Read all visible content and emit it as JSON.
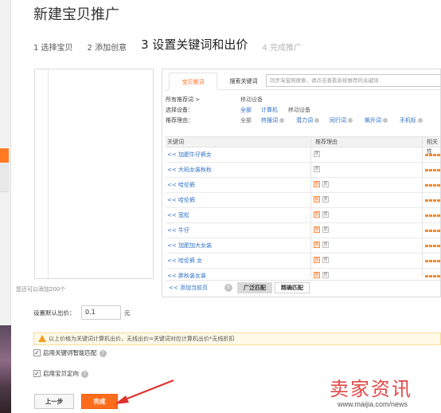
{
  "page": {
    "title": "新建宝贝推广"
  },
  "steps": [
    {
      "label": "1 选择宝贝"
    },
    {
      "label": "2 添加创意"
    },
    {
      "label": "3 设置关键词和出价"
    },
    {
      "label": "4 完成推广"
    }
  ],
  "product_panel": {
    "hint": "您还可以添加200个"
  },
  "keyword_panel": {
    "tabs": [
      {
        "label": "宝贝推词"
      },
      {
        "label": "搜索关键词"
      }
    ],
    "search_placeholder": "同步淘宝网搜索，请点击查看系统推荐的关键词",
    "filters": {
      "all_label": "所有推荐词 >",
      "all_value": "移动设备",
      "device_label": "选择设备：",
      "device_options": [
        "全部",
        "计算机",
        "移动设备"
      ],
      "reason_label": "推荐理由：",
      "reason_options": [
        "全部",
        "热搜词",
        "潜力词",
        "同行词",
        "飙升词",
        "手机标"
      ]
    },
    "table": {
      "headers": [
        "关键词",
        "推荐理由",
        "相关性"
      ],
      "rows": [
        {
          "keyword": "<< 加肥牛仔裤女",
          "tags": [
            "质"
          ]
        },
        {
          "keyword": "<< 大码女装秋秋",
          "tags": [
            "质"
          ]
        },
        {
          "keyword": "<< 哈伦裤",
          "tags": [
            "热",
            "质"
          ]
        },
        {
          "keyword": "<< 哈伦裤",
          "tags": [
            "热",
            "质"
          ]
        },
        {
          "keyword": "<< 宽松",
          "tags": [
            "热",
            "质"
          ]
        },
        {
          "keyword": "<< 牛仔",
          "tags": [
            "热",
            "质"
          ]
        },
        {
          "keyword": "<< 加肥加大女装",
          "tags": [
            "热",
            "质"
          ]
        },
        {
          "keyword": "<< 哈伦裤 女",
          "tags": [
            "热",
            "质"
          ]
        },
        {
          "keyword": "<< 胖秋装女装",
          "tags": [
            "热",
            "质"
          ]
        }
      ]
    },
    "footer": {
      "add_link": "<< 添加当前页",
      "help": "?",
      "broad_match": "广泛匹配",
      "exact_match": "精确匹配"
    }
  },
  "bid": {
    "label": "设置默认出价：",
    "value": "0.1",
    "unit": "元"
  },
  "notice": {
    "text": "以上价格为关键词计算机出价，无线出价=关键词对应计算机出价*无线折扣"
  },
  "options": [
    {
      "label": "启用关键词智能匹配",
      "checked": "✓",
      "help": "?"
    },
    {
      "label": "启用宝贝定向",
      "checked": "✓",
      "help": "?"
    }
  ],
  "buttons": {
    "prev": "上一步",
    "done": "完成"
  },
  "watermark": {
    "text": "卖家资讯",
    "url": "www.maijia.com/news"
  },
  "colors": {
    "accent": "#ff6d1c",
    "link": "#2c6fc6",
    "annotation_arrow": "#e0322e"
  }
}
